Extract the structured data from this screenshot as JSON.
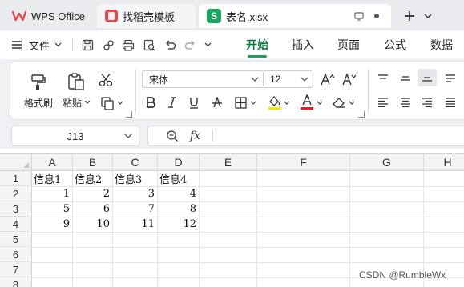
{
  "tabs": [
    {
      "label": "WPS Office",
      "icon": "wps-logo-icon"
    },
    {
      "label": "找稻壳模板",
      "icon": "docer-logo-icon"
    },
    {
      "label": "表名.xlsx",
      "icon": "spreadsheet-s-icon",
      "badge": "S"
    }
  ],
  "menu": {
    "file_label": "文件",
    "tabs": [
      "开始",
      "插入",
      "页面",
      "公式",
      "数据"
    ],
    "active_tab": "开始"
  },
  "ribbon": {
    "format_painter": "格式刷",
    "paste": "粘贴",
    "font_name": "宋体",
    "font_size": "12"
  },
  "formula_bar": {
    "cell_ref": "J13",
    "fx_label": "fx",
    "value": ""
  },
  "sheet": {
    "columns": [
      "A",
      "B",
      "C",
      "D",
      "E",
      "F",
      "G",
      "H"
    ],
    "rows": [
      "1",
      "2",
      "3",
      "4",
      "5",
      "6",
      "7",
      "8"
    ],
    "cells": [
      [
        "信息1",
        "信息2",
        "信息3",
        "信息4"
      ],
      [
        "1",
        "2",
        "3",
        "4"
      ],
      [
        "5",
        "6",
        "7",
        "8"
      ],
      [
        "9",
        "10",
        "11",
        "12"
      ]
    ]
  },
  "watermark": "CSDN @RumbleWx",
  "colors": {
    "accent_green": "#1aa35d",
    "wps_red": "#e5464f",
    "tabbar_bg": "#e9ebef"
  }
}
